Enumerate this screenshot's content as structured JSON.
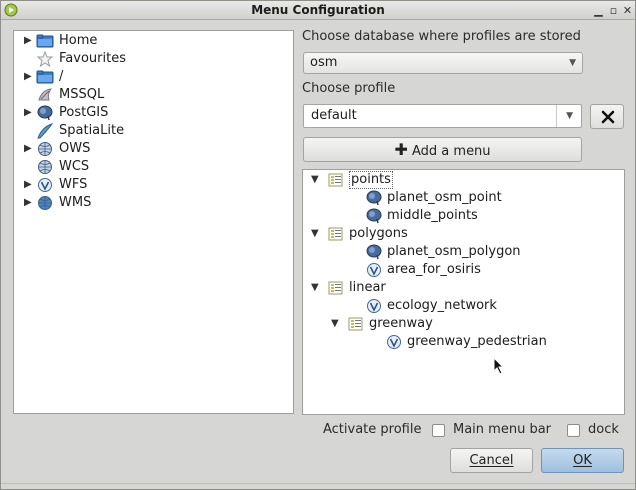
{
  "window": {
    "title": "Menu Configuration"
  },
  "browser_tree": [
    {
      "label": "Home",
      "icon": "folder-icon",
      "expandable": true
    },
    {
      "label": "Favourites",
      "icon": "star-icon",
      "expandable": false
    },
    {
      "label": "/",
      "icon": "folder-icon",
      "expandable": true
    },
    {
      "label": "MSSQL",
      "icon": "mssql-icon",
      "expandable": false
    },
    {
      "label": "PostGIS",
      "icon": "postgis-icon",
      "expandable": true
    },
    {
      "label": "SpatiaLite",
      "icon": "spatialite-icon",
      "expandable": false
    },
    {
      "label": "OWS",
      "icon": "ows-icon",
      "expandable": true
    },
    {
      "label": "WCS",
      "icon": "wcs-icon",
      "expandable": false
    },
    {
      "label": "WFS",
      "icon": "wfs-icon",
      "expandable": true
    },
    {
      "label": "WMS",
      "icon": "wms-icon",
      "expandable": true
    }
  ],
  "database": {
    "label": "Choose database where profiles are stored",
    "value": "osm"
  },
  "profile": {
    "label": "Choose profile",
    "value": "default"
  },
  "delete_button_icon": "close-icon",
  "add_menu": {
    "label": "Add a menu",
    "icon": "plus-icon"
  },
  "menu_tree": [
    {
      "label": "points",
      "icon": "menu-icon",
      "expanded": true,
      "level": 0
    },
    {
      "label": "planet_osm_point",
      "icon": "postgis-icon",
      "level": 1
    },
    {
      "label": "middle_points",
      "icon": "postgis-icon",
      "level": 1
    },
    {
      "label": "polygons",
      "icon": "menu-icon",
      "expanded": true,
      "level": 0
    },
    {
      "label": "planet_osm_polygon",
      "icon": "postgis-icon",
      "level": 1
    },
    {
      "label": "area_for_osiris",
      "icon": "vector-icon",
      "level": 1
    },
    {
      "label": "linear",
      "icon": "menu-icon",
      "expanded": true,
      "level": 0
    },
    {
      "label": "ecology_network",
      "icon": "vector-icon",
      "level": 1
    },
    {
      "label": "greenway",
      "icon": "menu-icon",
      "expanded": true,
      "level": 1
    },
    {
      "label": "greenway_pedestrian",
      "icon": "vector-icon",
      "level": 2
    }
  ],
  "activate": {
    "label": "Activate profile",
    "main_menu_bar": "Main menu bar",
    "dock": "dock"
  },
  "buttons": {
    "cancel": "Cancel",
    "ok": "OK"
  },
  "colors": {
    "accent": "#8fb4d6",
    "folder": "#3a7fd0",
    "menu_icon": "#c7c23a"
  }
}
